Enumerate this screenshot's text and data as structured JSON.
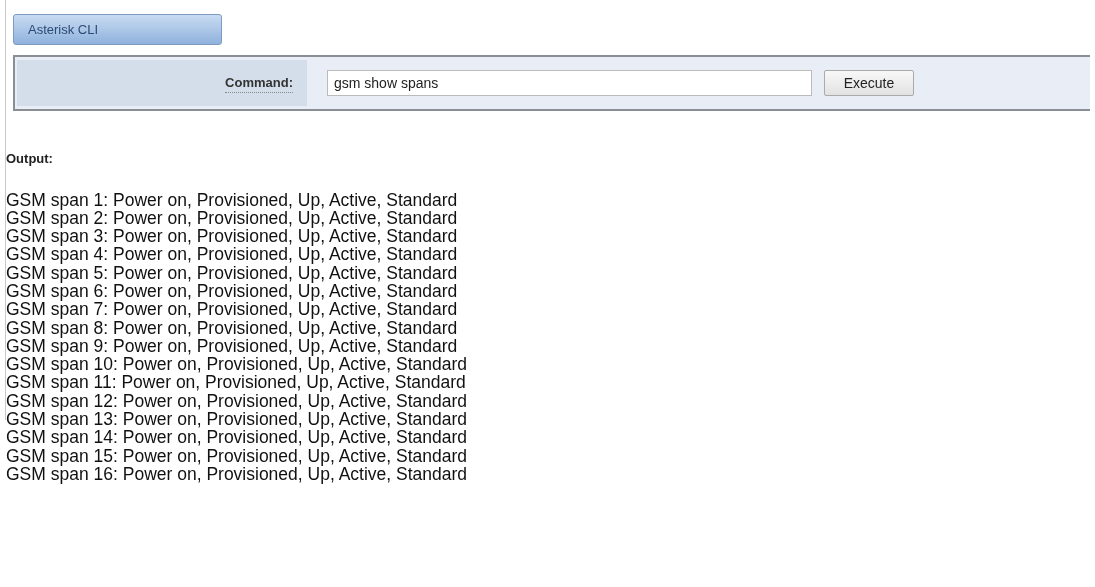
{
  "tab": {
    "label": "Asterisk CLI",
    "selected": true
  },
  "command": {
    "label": "Command:",
    "value": "gsm show spans",
    "button": "Execute"
  },
  "output": {
    "label": "Output:",
    "lines": [
      "GSM span 1: Power on, Provisioned, Up, Active, Standard",
      "GSM span 2: Power on, Provisioned, Up, Active, Standard",
      "GSM span 3: Power on, Provisioned, Up, Active, Standard",
      "GSM span 4: Power on, Provisioned, Up, Active, Standard",
      "GSM span 5: Power on, Provisioned, Up, Active, Standard",
      "GSM span 6: Power on, Provisioned, Up, Active, Standard",
      "GSM span 7: Power on, Provisioned, Up, Active, Standard",
      "GSM span 8: Power on, Provisioned, Up, Active, Standard",
      "GSM span 9: Power on, Provisioned, Up, Active, Standard",
      "GSM span 10: Power on, Provisioned, Up, Active, Standard",
      "GSM span 11: Power on, Provisioned, Up, Active, Standard",
      "GSM span 12: Power on, Provisioned, Up, Active, Standard",
      "GSM span 13: Power on, Provisioned, Up, Active, Standard",
      "GSM span 14: Power on, Provisioned, Up, Active, Standard",
      "GSM span 15: Power on, Provisioned, Up, Active, Standard",
      "GSM span 16: Power on, Provisioned, Up, Active, Standard"
    ]
  }
}
